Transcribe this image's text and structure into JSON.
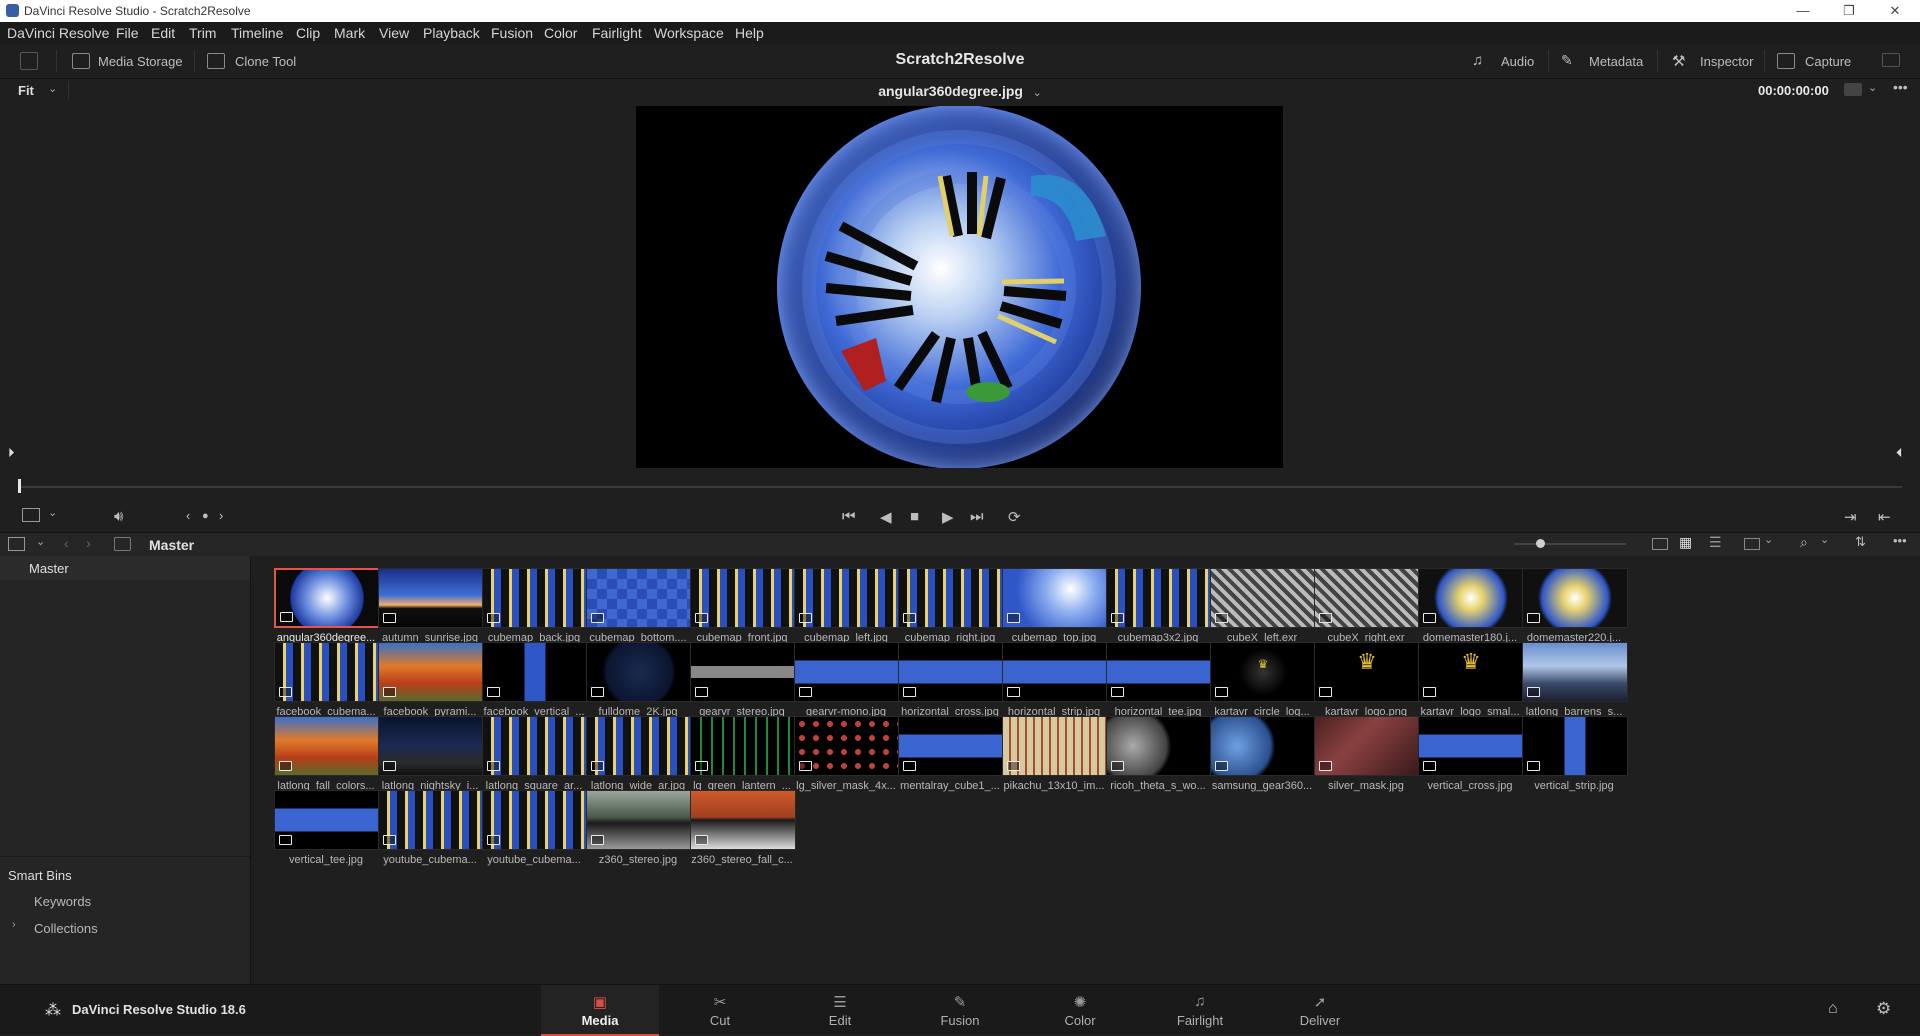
{
  "window": {
    "title": "DaVinci Resolve Studio - Scratch2Resolve",
    "minimize": "—",
    "maximize": "❐",
    "close": "✕"
  },
  "menu": [
    "DaVinci Resolve",
    "File",
    "Edit",
    "Trim",
    "Timeline",
    "Clip",
    "Mark",
    "View",
    "Playback",
    "Fusion",
    "Color",
    "Fairlight",
    "Workspace",
    "Help"
  ],
  "toolbar": {
    "media_storage": "Media Storage",
    "clone_tool": "Clone Tool",
    "project_title": "Scratch2Resolve",
    "audio": "Audio",
    "metadata": "Metadata",
    "inspector": "Inspector",
    "capture": "Capture"
  },
  "viewer": {
    "zoom": "Fit",
    "clip_name": "angular360degree.jpg",
    "timecode": "00:00:00:00",
    "playhead_fraction": 0
  },
  "pool": {
    "bin": "Master"
  },
  "sidebar": {
    "master": "Master",
    "smart_bins": "Smart Bins",
    "keywords": "Keywords",
    "collections": "Collections"
  },
  "clips": [
    {
      "name": "angular360degree...",
      "thumb": "fisheye",
      "selected": true
    },
    {
      "name": "autumn_sunrise.jpg",
      "thumb": "sunrise"
    },
    {
      "name": "cubemap_back.jpg",
      "thumb": "cubeface"
    },
    {
      "name": "cubemap_bottom....",
      "thumb": "bluecheck"
    },
    {
      "name": "cubemap_front.jpg",
      "thumb": "cubeface"
    },
    {
      "name": "cubemap_left.jpg",
      "thumb": "cubeface"
    },
    {
      "name": "cubemap_right.jpg",
      "thumb": "cubeface"
    },
    {
      "name": "cubemap_top.jpg",
      "thumb": "sky"
    },
    {
      "name": "cubemap3x2.jpg",
      "thumb": "cubeface"
    },
    {
      "name": "cubeX_left.exr",
      "thumb": "grayscale"
    },
    {
      "name": "cubeX_right.exr",
      "thumb": "grayscale"
    },
    {
      "name": "domemaster180.j...",
      "thumb": "dome"
    },
    {
      "name": "domemaster220.j...",
      "thumb": "dome"
    },
    {
      "name": "facebook_cubema...",
      "thumb": "cubeface"
    },
    {
      "name": "facebook_pyrami...",
      "thumb": "autumn"
    },
    {
      "name": "facebook_vertical_...",
      "thumb": "strip"
    },
    {
      "name": "fulldome_2K.jpg",
      "thumb": "moon"
    },
    {
      "name": "gearvr_stereo.jpg",
      "thumb": "graystrip"
    },
    {
      "name": "gearvr-mono.jpg",
      "thumb": "hstrip"
    },
    {
      "name": "horizontal_cross.jpg",
      "thumb": "cross"
    },
    {
      "name": "horizontal_strip.jpg",
      "thumb": "hstrip"
    },
    {
      "name": "horizontal_tee.jpg",
      "thumb": "cross"
    },
    {
      "name": "kartavr_circle_log...",
      "thumb": "logosmall"
    },
    {
      "name": "kartavr_logo.png",
      "thumb": "logo"
    },
    {
      "name": "kartavr_logo_smal...",
      "thumb": "logo"
    },
    {
      "name": "latlong_barrens_s...",
      "thumb": "landscape"
    },
    {
      "name": "latlong_fall_colors...",
      "thumb": "autumn"
    },
    {
      "name": "latlong_nightsky_i...",
      "thumb": "night"
    },
    {
      "name": "latlong_square_ar...",
      "thumb": "cubeface"
    },
    {
      "name": "latlong_wide_ar.jpg",
      "thumb": "cubeface"
    },
    {
      "name": "lg_green_lantern_...",
      "thumb": "green"
    },
    {
      "name": "lg_silver_mask_4x...",
      "thumb": "masks"
    },
    {
      "name": "mentalray_cube1_...",
      "thumb": "hstrip"
    },
    {
      "name": "pikachu_13x10_im...",
      "thumb": "pikachu"
    },
    {
      "name": "ricoh_theta_s_wo...",
      "thumb": "ricoh"
    },
    {
      "name": "samsung_gear360...",
      "thumb": "gear360"
    },
    {
      "name": "silver_mask.jpg",
      "thumb": "silver"
    },
    {
      "name": "vertical_cross.jpg",
      "thumb": "cross"
    },
    {
      "name": "vertical_strip.jpg",
      "thumb": "vstrip"
    },
    {
      "name": "vertical_tee.jpg",
      "thumb": "cross"
    },
    {
      "name": "youtube_cubema...",
      "thumb": "cubeface"
    },
    {
      "name": "youtube_cubema...",
      "thumb": "cubeface"
    },
    {
      "name": "z360_stereo.jpg",
      "thumb": "z360"
    },
    {
      "name": "z360_stereo_fall_c...",
      "thumb": "z360fall"
    }
  ],
  "bottom": {
    "product": "DaVinci Resolve Studio 18.6",
    "pages": [
      "Media",
      "Cut",
      "Edit",
      "Fusion",
      "Color",
      "Fairlight",
      "Deliver"
    ],
    "active_page": "Media"
  },
  "colors": {
    "accent": "#d84f44",
    "panel": "#1f1f20",
    "selected_border": "#e0564c"
  }
}
